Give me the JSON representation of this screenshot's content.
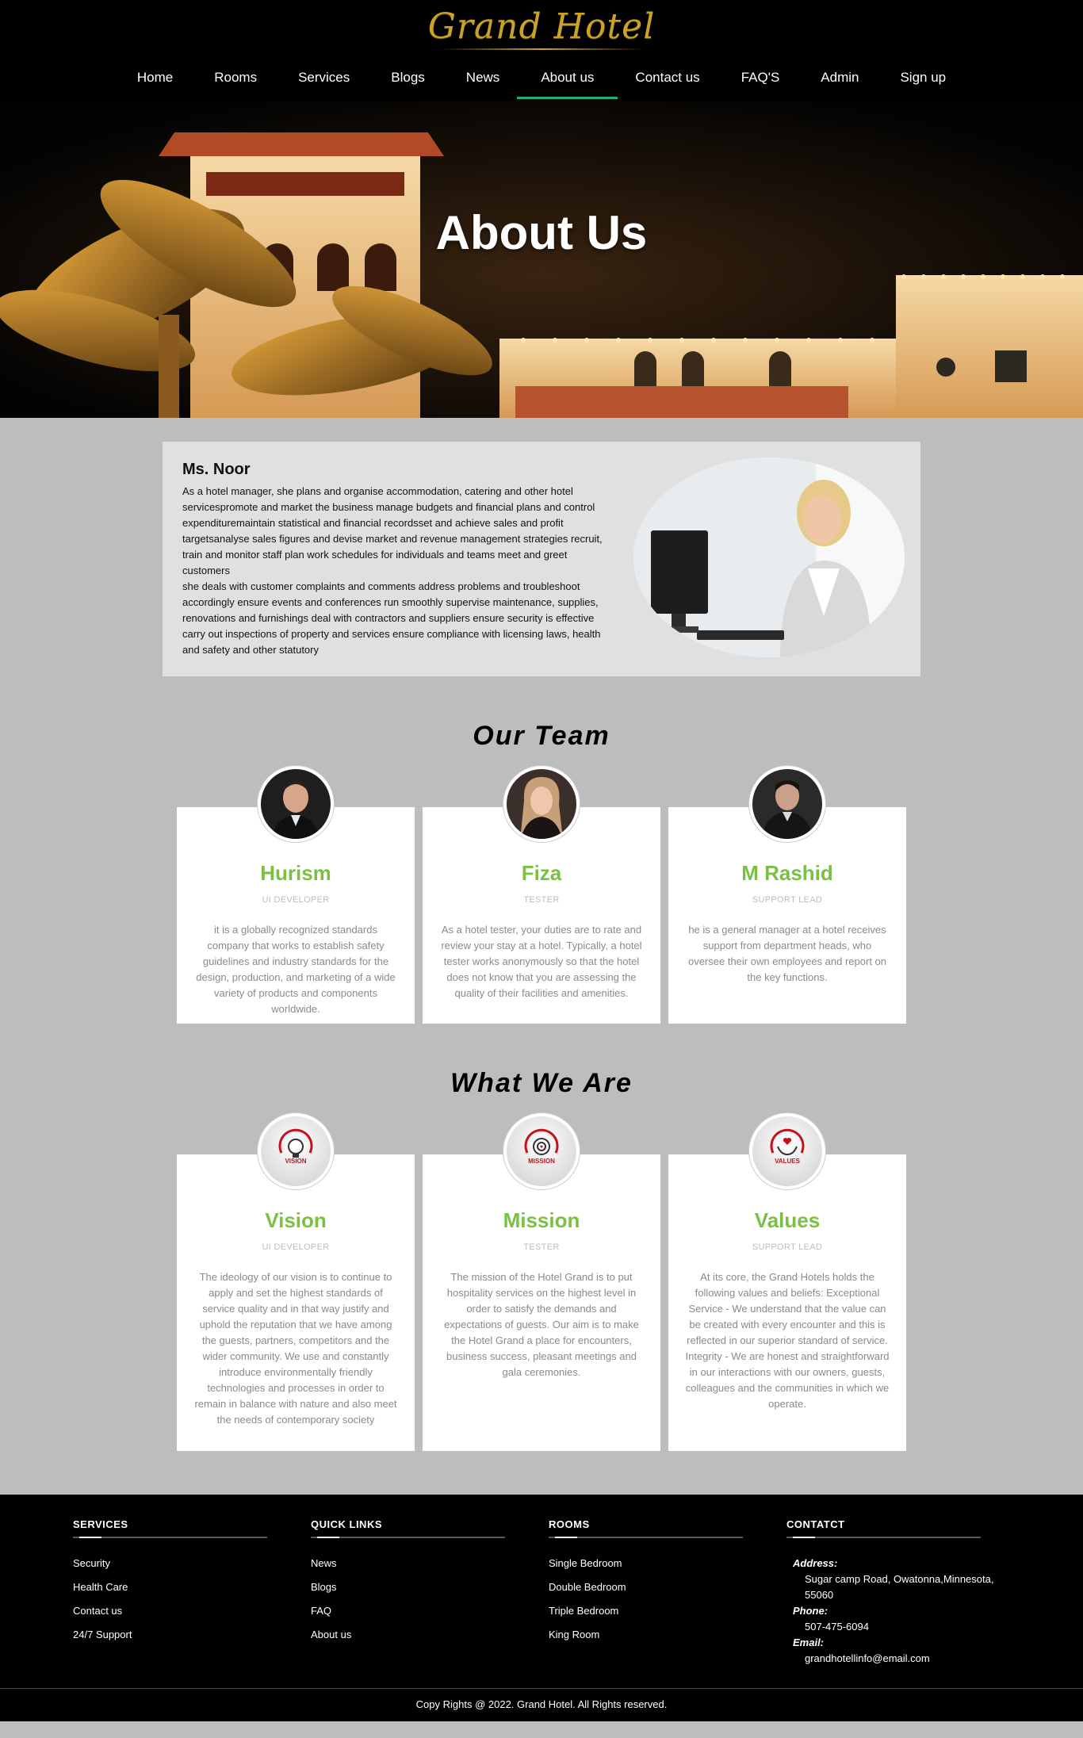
{
  "header": {
    "logo": "Grand Hotel",
    "nav": [
      {
        "label": "Home"
      },
      {
        "label": "Rooms"
      },
      {
        "label": "Services"
      },
      {
        "label": "Blogs"
      },
      {
        "label": "News"
      },
      {
        "label": "About us",
        "active": true
      },
      {
        "label": "Contact us"
      },
      {
        "label": "FAQ'S"
      },
      {
        "label": "Admin"
      },
      {
        "label": "Sign up"
      }
    ]
  },
  "hero": {
    "title": "About Us"
  },
  "intro": {
    "name": "Ms. Noor",
    "paragraph1": "As a hotel manager, she plans and organise accommodation, catering and other hotel servicespromote and market the business manage budgets and financial plans and control expendituremaintain statistical and financial recordsset and achieve sales and profit targetsanalyse sales figures and devise market and revenue management strategies recruit, train and monitor staff plan work schedules for individuals and teams meet and greet customers",
    "paragraph2": "she deals with customer complaints and comments address problems and troubleshoot accordingly ensure events and conferences run smoothly supervise maintenance, supplies, renovations and furnishings deal with contractors and suppliers ensure security is effective carry out inspections of property and services ensure compliance with licensing laws, health and safety and other statutory"
  },
  "team": {
    "title": "Our Team",
    "members": [
      {
        "name": "Hurism",
        "role": "UI DEVELOPER",
        "desc": "it is a globally recognized standards company that works to establish safety guidelines and industry standards for the design, production, and marketing of a wide variety of products and components worldwide."
      },
      {
        "name": "Fiza",
        "role": "TESTER",
        "desc": "As a hotel tester, your duties are to rate and review your stay at a hotel. Typically, a hotel tester works anonymously so that the hotel does not know that you are assessing the quality of their facilities and amenities."
      },
      {
        "name": "M Rashid",
        "role": "SUPPORT LEAD",
        "desc": "he is a general manager at a hotel receives support from department heads, who oversee their own employees and report on the key functions."
      }
    ]
  },
  "what": {
    "title": "What We Are",
    "items": [
      {
        "name": "Vision",
        "badge": "VISION",
        "role": "UI DEVELOPER",
        "desc": "The ideology of our vision is to continue to apply and set the highest standards of service quality and in that way justify and uphold the reputation that we have among the guests, partners, competitors and the wider community. We use and constantly introduce environmentally friendly technologies and processes in order to remain in balance with nature and also meet the needs of contemporary society"
      },
      {
        "name": "Mission",
        "badge": "MISSION",
        "role": "TESTER",
        "desc": "The mission of the Hotel Grand is to put hospitality services on the highest level in order to satisfy the demands and expectations of guests. Our aim is to make the Hotel Grand a place for encounters, business success, pleasant meetings and gala ceremonies."
      },
      {
        "name": "Values",
        "badge": "VALUES",
        "role": "SUPPORT LEAD",
        "desc": "At its core, the Grand Hotels holds the following values and beliefs: Exceptional Service - We understand that the value can be created with every encounter and this is reflected in our superior standard of service. Integrity - We are honest and straightforward in our interactions with our owners, guests, colleagues and the communities in which we operate."
      }
    ]
  },
  "footer": {
    "services": {
      "heading": "SERVICES",
      "links": [
        "Security",
        "Health Care",
        "Contact us",
        "24/7 Support"
      ]
    },
    "quick_links": {
      "heading": "QUICK LINKS",
      "links": [
        "News",
        "Blogs",
        "FAQ",
        "About us"
      ]
    },
    "rooms": {
      "heading": "ROOMS",
      "links": [
        "Single Bedroom",
        "Double Bedroom",
        "Triple Bedroom",
        "King Room"
      ]
    },
    "contact": {
      "heading": "CONTATCT",
      "address_label": "Address:",
      "address": "Sugar camp Road, Owatonna,Minnesota, 55060",
      "phone_label": "Phone:",
      "phone": "507-475-6094",
      "email_label": "Email:",
      "email": "grandhotellinfo@email.com"
    },
    "copyright": "Copy Rights @ 2022. Grand Hotel. All Rights reserved."
  },
  "colors": {
    "accent_green": "#7ac143",
    "nav_active": "#1cae73",
    "badge_red": "#c3121a",
    "logo_gold": "#c9a227"
  }
}
